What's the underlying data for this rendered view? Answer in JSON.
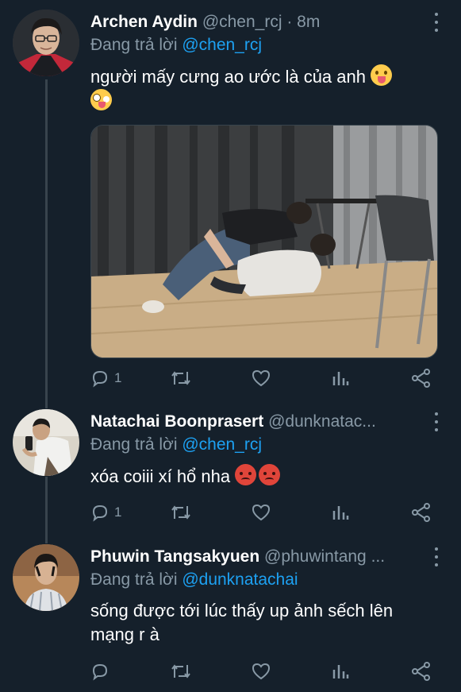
{
  "tweets": [
    {
      "name": "Archen Aydin",
      "handle": "@chen_rcj",
      "time": "· 8m",
      "reply_prefix": "Đang trả lời",
      "reply_mention": "@chen_rcj",
      "text": "người mấy cưng ao ước là của anh",
      "emojis": [
        "face-with-tongue-emoji",
        "zany-face-emoji"
      ],
      "has_media": true,
      "actions": {
        "reply_count": "1",
        "retweet_count": "",
        "like_count": ""
      }
    },
    {
      "name": "Natachai Boonprasert",
      "handle": "@dunknatac...",
      "time": "",
      "reply_prefix": "Đang trả lời",
      "reply_mention": "@chen_rcj",
      "text": "xóa coiii xí hổ nha",
      "emojis": [
        "angry-face-emoji",
        "angry-face-emoji"
      ],
      "has_media": false,
      "actions": {
        "reply_count": "1",
        "retweet_count": "",
        "like_count": ""
      }
    },
    {
      "name": "Phuwin Tangsakyuen",
      "handle": "@phuwintang ...",
      "time": "",
      "reply_prefix": "Đang trả lời",
      "reply_mention": "@dunknatachai",
      "text_line1": "sống được tới lúc thấy up ảnh sếch lên",
      "text_line2": "mạng r à",
      "has_media": false,
      "actions": {
        "reply_count": "",
        "retweet_count": "",
        "like_count": ""
      }
    }
  ],
  "icons": {
    "reply": "reply-icon",
    "retweet": "retweet-icon",
    "like": "heart-icon",
    "analytics": "analytics-icon",
    "share": "share-icon",
    "more": "more-options-icon"
  },
  "colors": {
    "background": "#15202b",
    "secondary_text": "#8899a6",
    "mention": "#1da1f2",
    "thread_line": "#38444d"
  }
}
